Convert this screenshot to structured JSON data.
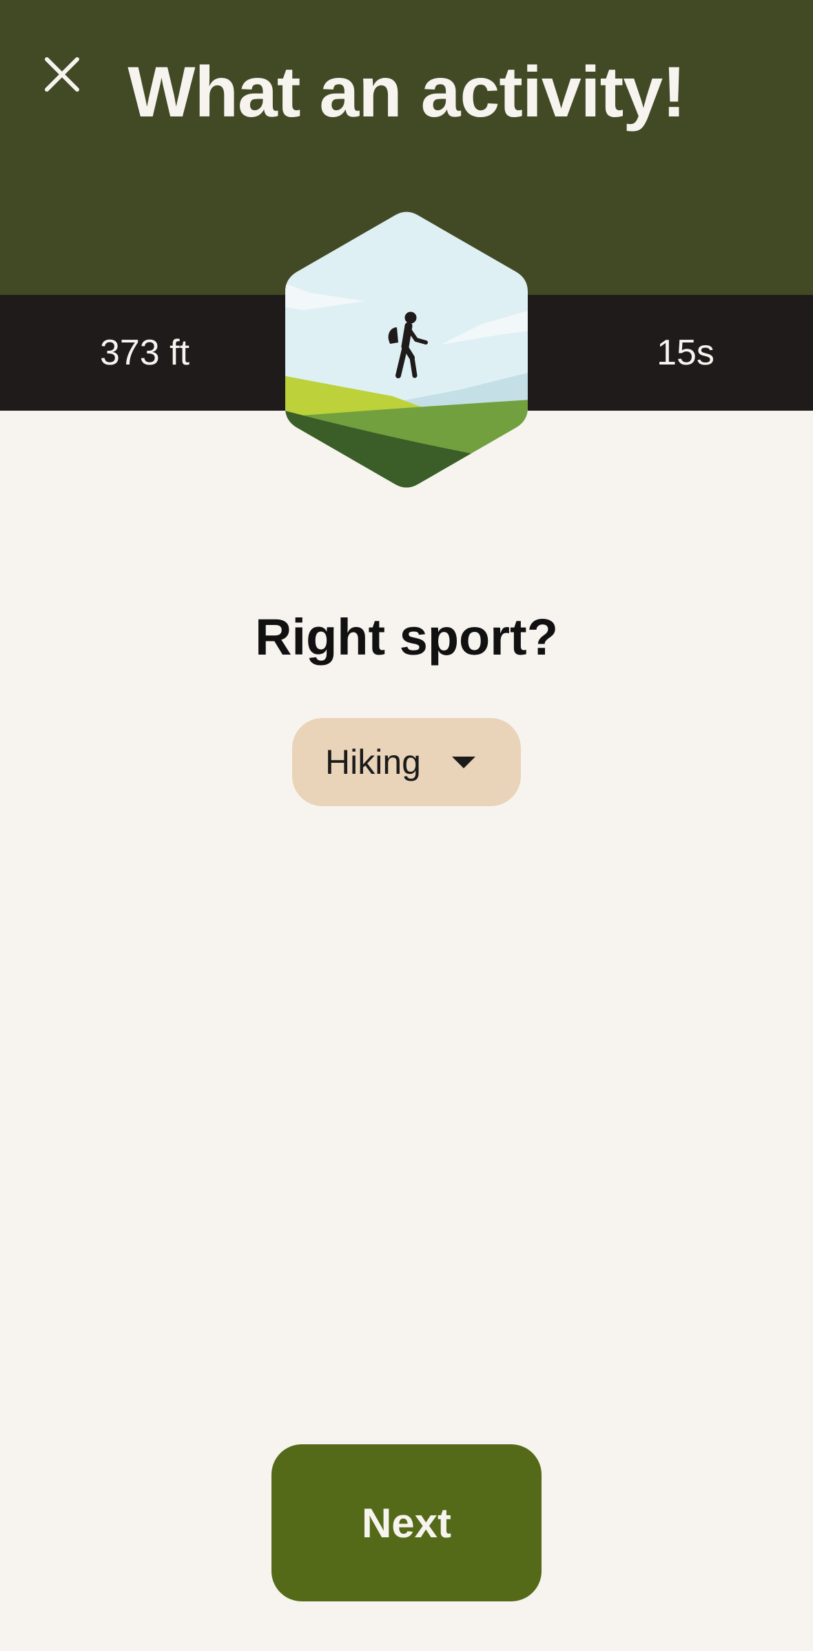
{
  "header": {
    "title": "What an activity!",
    "close_icon": "close-icon",
    "background_color": "#414925"
  },
  "stats": {
    "distance": "373 ft",
    "duration": "15s",
    "background_color": "#1e1b1a"
  },
  "badge": {
    "icon": "hiker-icon"
  },
  "sport_prompt": {
    "question": "Right sport?",
    "selected": "Hiking",
    "dropdown_icon": "caret-down-icon",
    "background_color": "#e9d3b9"
  },
  "actions": {
    "next_label": "Next",
    "button_color": "#546a18"
  }
}
